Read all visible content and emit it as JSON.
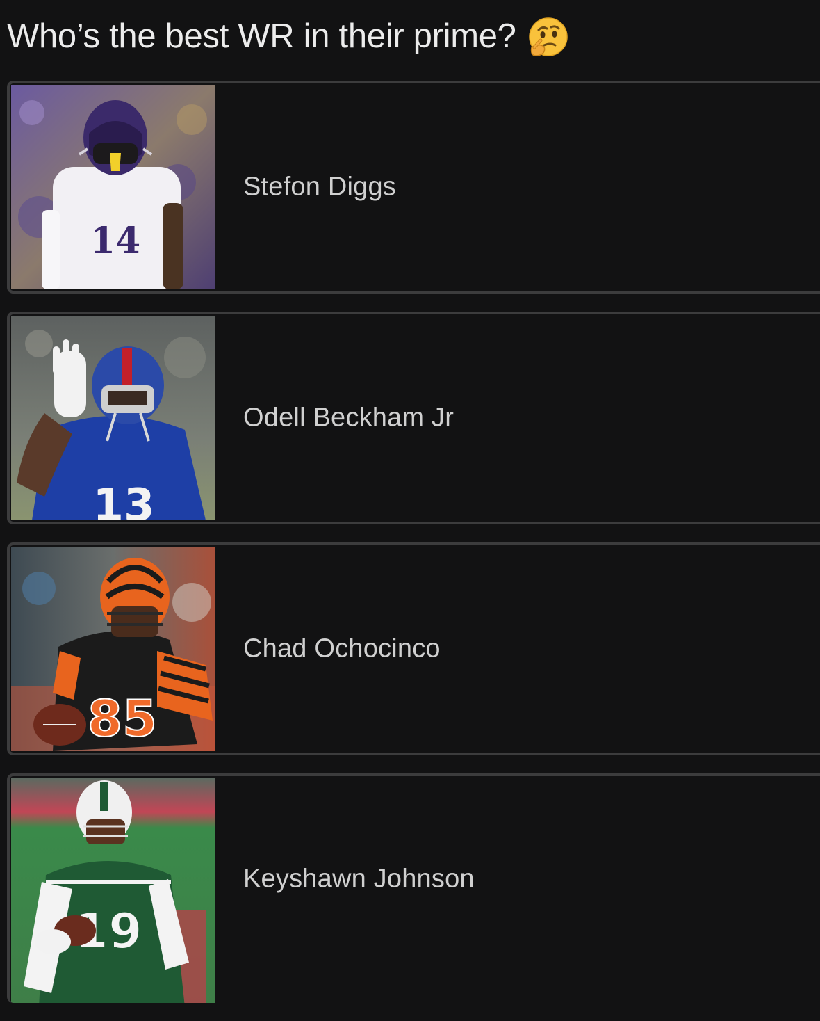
{
  "poll": {
    "question": "Who’s the best WR in their prime?",
    "question_emoji": "thinking-face-icon",
    "options": [
      {
        "label": "Stefon Diggs",
        "jersey_number": "14",
        "image": "player-photo-purple-white-jersey"
      },
      {
        "label": "Odell Beckham Jr",
        "jersey_number": "13",
        "image": "player-photo-blue-jersey"
      },
      {
        "label": "Chad Ochocinco",
        "jersey_number": "85",
        "image": "player-photo-black-orange-striped-jersey"
      },
      {
        "label": "Keyshawn Johnson",
        "jersey_number": "19",
        "image": "player-photo-green-jersey"
      }
    ]
  },
  "colors": {
    "background": "#121213",
    "card_border": "#3c3c3d",
    "option_text": "#d0d0d0",
    "question_text": "#ececec"
  }
}
